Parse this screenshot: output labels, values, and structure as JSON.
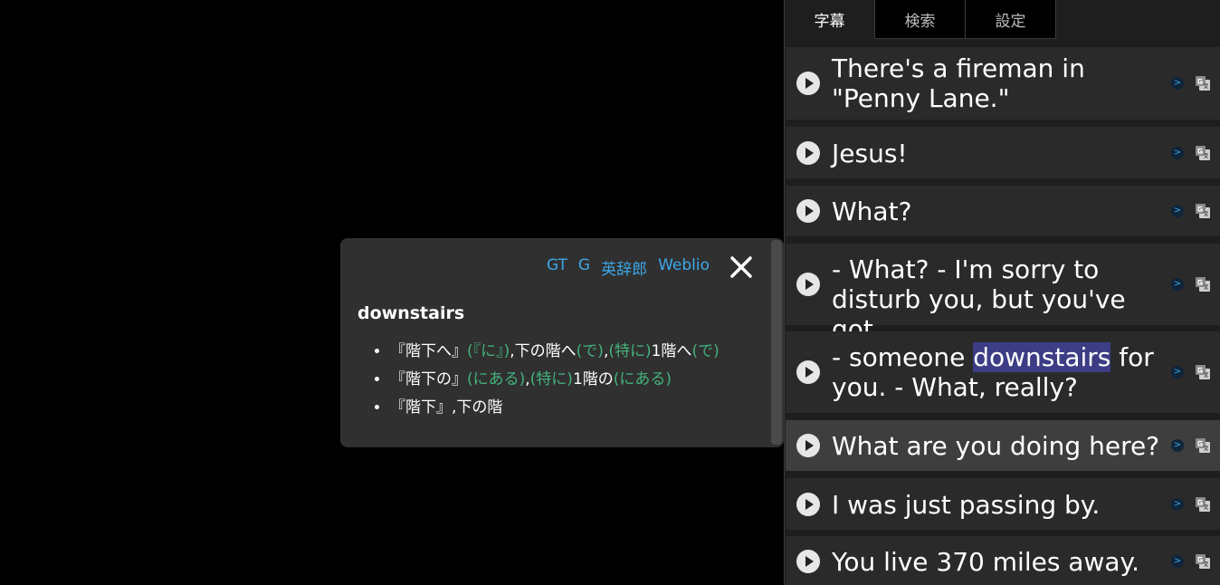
{
  "dictionary": {
    "links": [
      "GT",
      "G",
      "英辞郎",
      "Weblio"
    ],
    "close_icon": "close-icon",
    "word": "downstairs",
    "definitions": [
      [
        {
          "text": "『階下へ』",
          "style": "main"
        },
        {
          "text": "(『に』)",
          "style": "note"
        },
        {
          "text": ",下の階へ",
          "style": "main"
        },
        {
          "text": "(で)",
          "style": "note"
        },
        {
          "text": ",",
          "style": "main"
        },
        {
          "text": "(特に)",
          "style": "note"
        },
        {
          "text": "1階へ",
          "style": "main"
        },
        {
          "text": "(で)",
          "style": "note"
        }
      ],
      [
        {
          "text": "『階下の』",
          "style": "main"
        },
        {
          "text": "(にある)",
          "style": "note"
        },
        {
          "text": ",",
          "style": "main"
        },
        {
          "text": "(特に)",
          "style": "note"
        },
        {
          "text": "1階の",
          "style": "main"
        },
        {
          "text": "(にある)",
          "style": "note"
        }
      ],
      [
        {
          "text": "『階下』,下の階",
          "style": "main"
        }
      ]
    ],
    "note_color": "#44b27c",
    "link_color": "#3ea7e8"
  },
  "tabs": [
    {
      "label": "字幕",
      "active": true
    },
    {
      "label": "検索",
      "active": false
    },
    {
      "label": "設定",
      "active": false
    }
  ],
  "subtitles": [
    {
      "text": "There's a fireman in \"Penny Lane.\""
    },
    {
      "text": "Jesus!"
    },
    {
      "text": "What?"
    },
    {
      "text": "- What? - I'm sorry to disturb you, but you've got"
    },
    {
      "before": "- someone ",
      "highlight": "downstairs",
      "after": " for you. - What, really?"
    },
    {
      "text": "What are you doing here?",
      "current": true
    },
    {
      "text": "I was just passing by."
    },
    {
      "text": "You live 370 miles away."
    }
  ],
  "row_icons": {
    "play": "play-icon",
    "translate_arrow": "chevron-right-icon",
    "google_translate": "google-translate-icon"
  },
  "translate_arrow_glyph": ">",
  "highlight_color": "#3c3d85"
}
